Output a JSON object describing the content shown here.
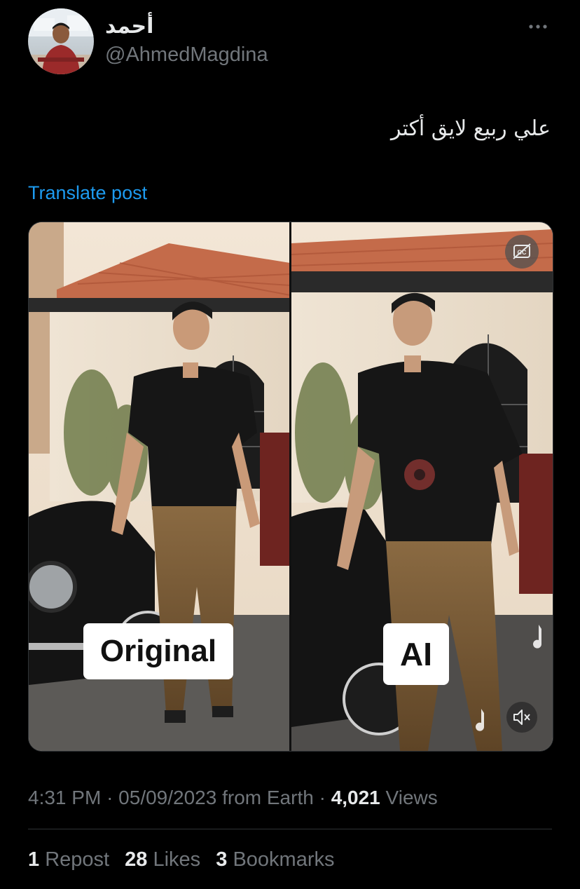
{
  "author": {
    "display_name": "أحمد",
    "handle": "@AhmedMagdina"
  },
  "post": {
    "text": "علي ربيع لايق أكتر",
    "translate_label": "Translate post"
  },
  "media": {
    "left_label": "Original",
    "right_label": "AI",
    "cc_icon": "closed-captions-icon",
    "mute_icon": "mute-icon"
  },
  "meta": {
    "time": "4:31 PM",
    "sep1": "·",
    "date": "05/09/2023",
    "source": "from Earth",
    "sep2": "·",
    "views_count": "4,021",
    "views_label": "Views"
  },
  "stats": {
    "reposts_count": "1",
    "reposts_label": "Repost",
    "likes_count": "28",
    "likes_label": "Likes",
    "bookmarks_count": "3",
    "bookmarks_label": "Bookmarks"
  },
  "colors": {
    "background": "#000000",
    "text": "#e7e9ea",
    "secondary": "#71767b",
    "link": "#1d9bf0"
  }
}
